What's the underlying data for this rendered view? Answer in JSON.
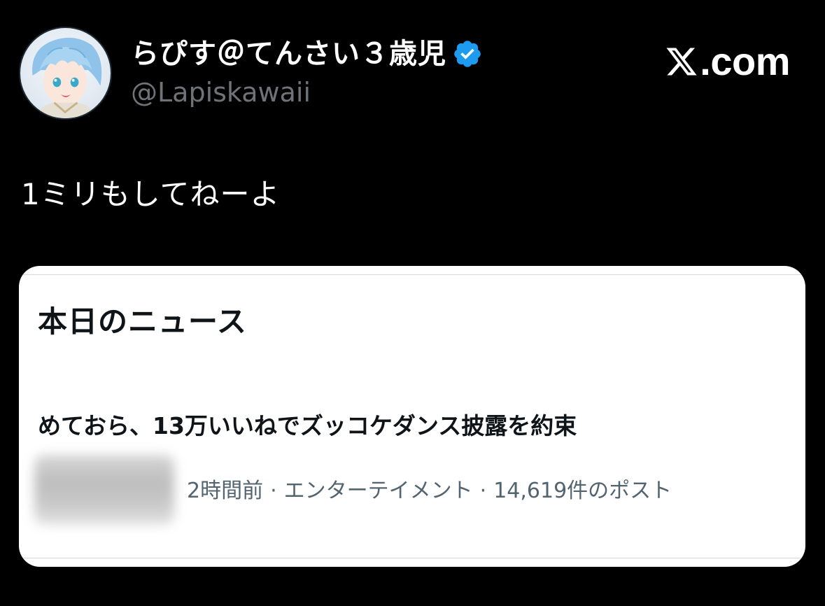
{
  "header": {
    "display_name": "らぴす＠てんさい３歳児",
    "handle": "@Lapiskawaii",
    "verified_icon": "verified-badge-icon",
    "brand_text": ".com",
    "brand_icon": "x-logo-icon",
    "verified_color": "#1d9bf0"
  },
  "tweet": {
    "text": "1ミリもしてねーよ"
  },
  "embedded_card": {
    "heading": "本日のニュース",
    "headline": "めておら、13万いいねでズッコケダンス披露を約束",
    "meta": {
      "time": "2時間前",
      "category": "エンターテイメント",
      "posts": "14,619件のポスト",
      "separator": "·"
    }
  }
}
